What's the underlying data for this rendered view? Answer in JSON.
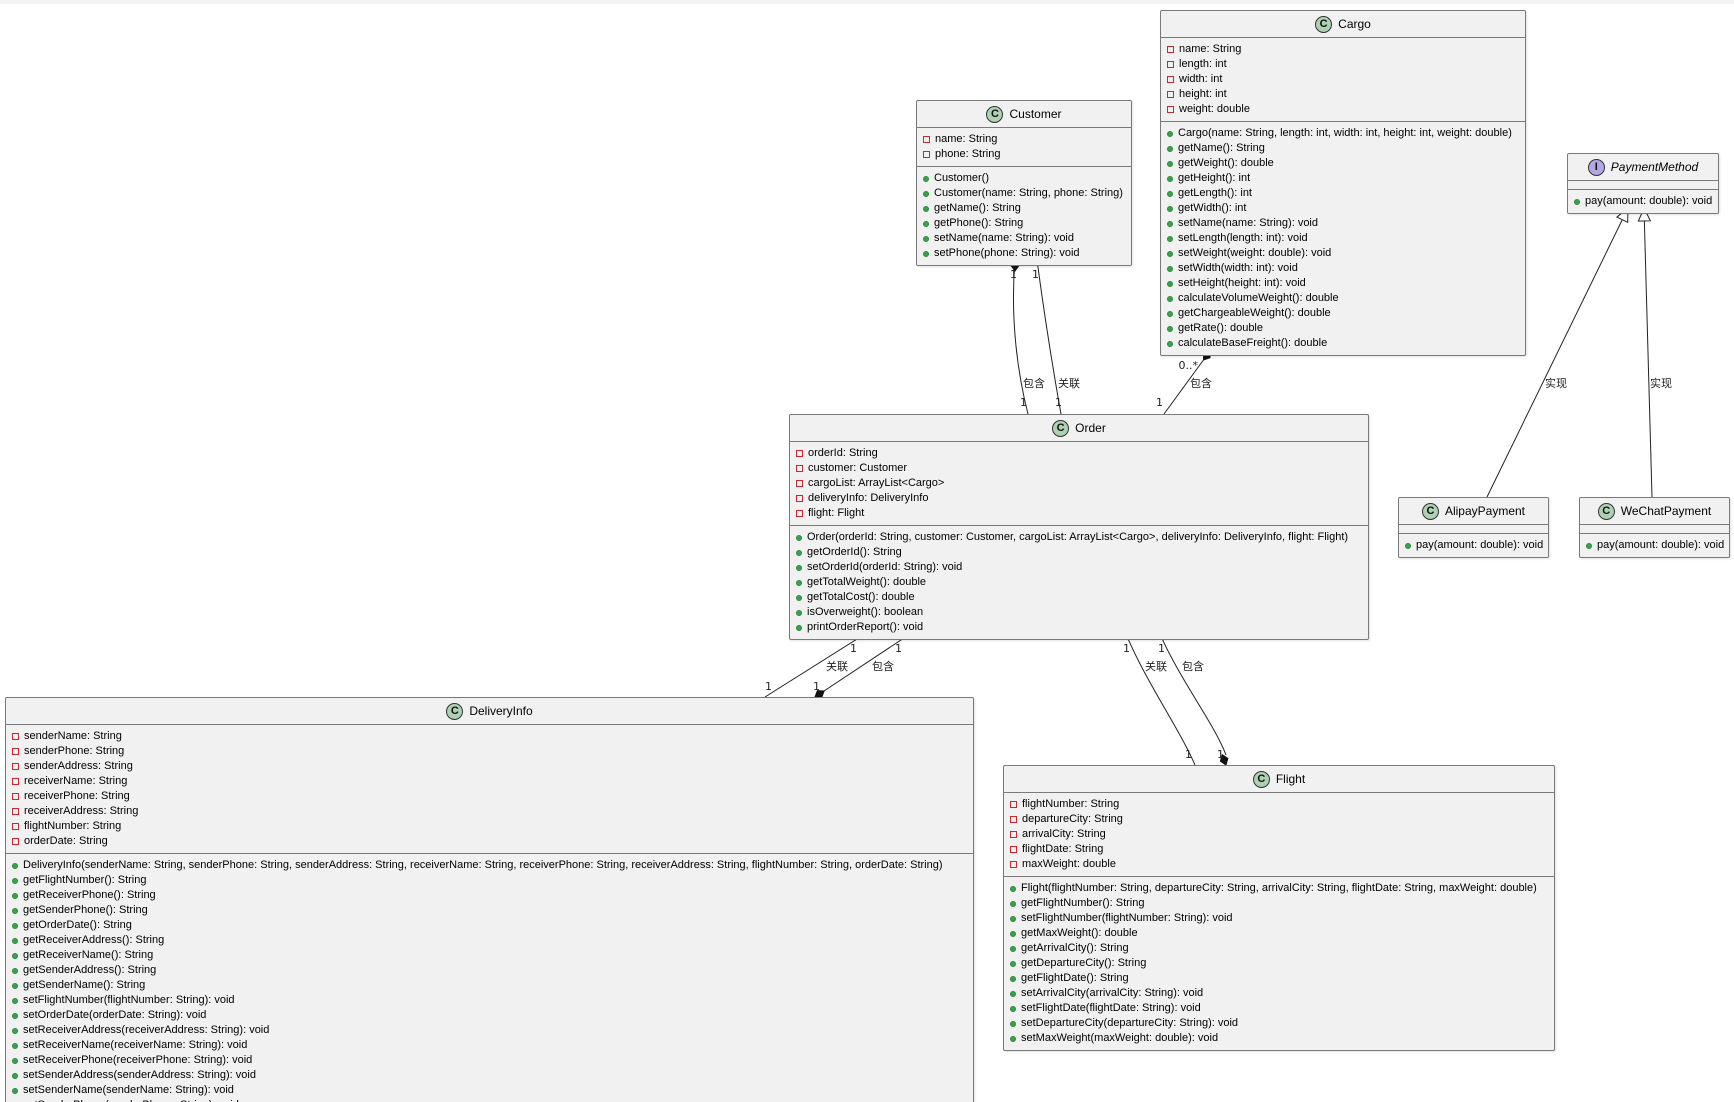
{
  "diagram": {
    "classes": [
      {
        "id": "cargo",
        "kind": "class",
        "name": "Cargo",
        "attributes": [
          "name: String",
          "length: int",
          "width: int",
          "height: int",
          "weight: double"
        ],
        "methods": [
          "Cargo(name: String, length: int, width: int, height: int, weight: double)",
          "getName(): String",
          "getWeight(): double",
          "getHeight(): int",
          "getLength(): int",
          "getWidth(): int",
          "setName(name: String): void",
          "setLength(length: int): void",
          "setWeight(weight: double): void",
          "setWidth(width: int): void",
          "setHeight(height: int): void",
          "calculateVolumeWeight(): double",
          "getChargeableWeight(): double",
          "getRate(): double",
          "calculateBaseFreight(): double"
        ]
      },
      {
        "id": "customer",
        "kind": "class",
        "name": "Customer",
        "attributes": [
          "name: String",
          "phone: String"
        ],
        "methods": [
          "Customer()",
          "Customer(name: String, phone: String)",
          "getName(): String",
          "getPhone(): String",
          "setName(name: String): void",
          "setPhone(phone: String): void"
        ]
      },
      {
        "id": "paymentmethod",
        "kind": "interface",
        "name": "PaymentMethod",
        "attributes": [],
        "methods": [
          "pay(amount: double): void"
        ]
      },
      {
        "id": "order",
        "kind": "class",
        "name": "Order",
        "attributes": [
          "orderId: String",
          "customer: Customer",
          "cargoList: ArrayList<Cargo>",
          "deliveryInfo: DeliveryInfo",
          "flight: Flight"
        ],
        "methods": [
          "Order(orderId: String, customer: Customer, cargoList: ArrayList<Cargo>, deliveryInfo: DeliveryInfo, flight: Flight)",
          "getOrderId(): String",
          "setOrderId(orderId: String): void",
          "getTotalWeight(): double",
          "getTotalCost(): double",
          "isOverweight(): boolean",
          "printOrderReport(): void"
        ]
      },
      {
        "id": "alipay",
        "kind": "class",
        "name": "AlipayPayment",
        "attributes": [],
        "methods": [
          "pay(amount: double): void"
        ]
      },
      {
        "id": "wechat",
        "kind": "class",
        "name": "WeChatPayment",
        "attributes": [],
        "methods": [
          "pay(amount: double): void"
        ]
      },
      {
        "id": "deliveryinfo",
        "kind": "class",
        "name": "DeliveryInfo",
        "attributes": [
          "senderName: String",
          "senderPhone: String",
          "senderAddress: String",
          "receiverName: String",
          "receiverPhone: String",
          "receiverAddress: String",
          "flightNumber: String",
          "orderDate: String"
        ],
        "methods": [
          "DeliveryInfo(senderName: String, senderPhone: String, senderAddress: String, receiverName: String, receiverPhone: String, receiverAddress: String, flightNumber: String, orderDate: String)",
          "getFlightNumber(): String",
          "getReceiverPhone(): String",
          "getSenderPhone(): String",
          "getOrderDate(): String",
          "getReceiverAddress(): String",
          "getReceiverName(): String",
          "getSenderAddress(): String",
          "getSenderName(): String",
          "setFlightNumber(flightNumber: String): void",
          "setOrderDate(orderDate: String): void",
          "setReceiverAddress(receiverAddress: String): void",
          "setReceiverName(receiverName: String): void",
          "setReceiverPhone(receiverPhone: String): void",
          "setSenderAddress(senderAddress: String): void",
          "setSenderName(senderName: String): void",
          "setSenderPhone(senderPhone: String): void"
        ]
      },
      {
        "id": "flight",
        "kind": "class",
        "name": "Flight",
        "attributes": [
          "flightNumber: String",
          "departureCity: String",
          "arrivalCity: String",
          "flightDate: String",
          "maxWeight: double"
        ],
        "methods": [
          "Flight(flightNumber: String, departureCity: String, arrivalCity: String, flightDate: String, maxWeight: double)",
          "getFlightNumber(): String",
          "setFlightNumber(flightNumber: String): void",
          "getMaxWeight(): double",
          "getArrivalCity(): String",
          "getDepartureCity(): String",
          "getFlightDate(): String",
          "setArrivalCity(arrivalCity: String): void",
          "setFlightDate(flightDate: String): void",
          "setDepartureCity(departureCity: String): void",
          "setMaxWeight(maxWeight: double): void"
        ]
      }
    ],
    "relations": [
      {
        "id": "customer-order-contains",
        "type": "composition",
        "label": "包含",
        "from_mult": "1",
        "to_mult": "1"
      },
      {
        "id": "customer-order-assoc",
        "type": "association",
        "label": "关联",
        "from_mult": "1",
        "to_mult": "1"
      },
      {
        "id": "cargo-order-contains",
        "type": "composition",
        "label": "包含",
        "from_mult": "0..*",
        "to_mult": "1"
      },
      {
        "id": "alipay-impl",
        "type": "realization",
        "label": "实现"
      },
      {
        "id": "wechat-impl",
        "type": "realization",
        "label": "实现"
      },
      {
        "id": "order-delivery-assoc",
        "type": "association",
        "label": "关联",
        "from_mult": "1",
        "to_mult": "1"
      },
      {
        "id": "order-delivery-contains",
        "type": "composition",
        "label": "包含",
        "from_mult": "1",
        "to_mult": "1"
      },
      {
        "id": "order-flight-assoc",
        "type": "association",
        "label": "关联",
        "from_mult": "1",
        "to_mult": "1"
      },
      {
        "id": "order-flight-contains",
        "type": "composition",
        "label": "包含",
        "from_mult": "1",
        "to_mult": "1"
      }
    ]
  }
}
